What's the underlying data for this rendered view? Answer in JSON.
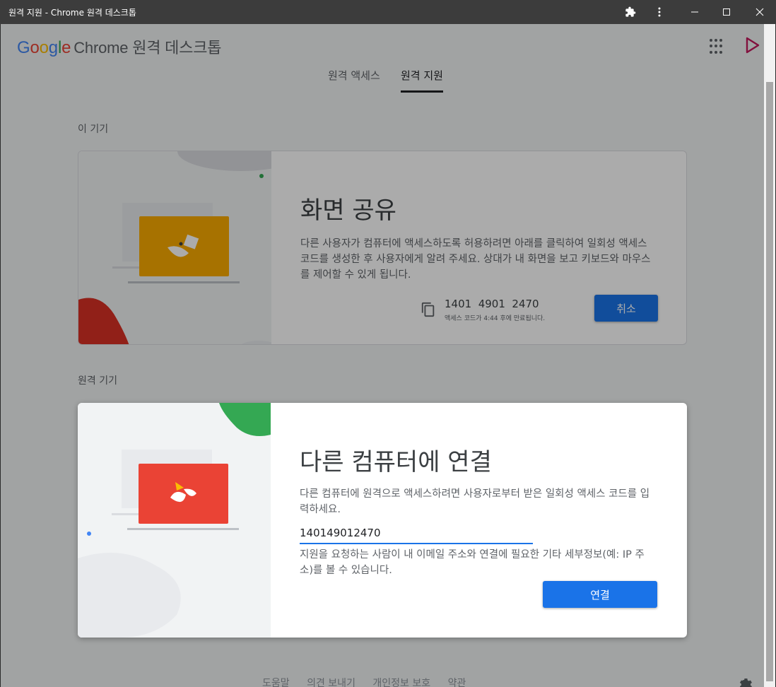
{
  "window": {
    "title": "원격 지원 - Chrome 원격 데스크톱",
    "icons": [
      "extension-icon",
      "more-vert-icon",
      "minimize-icon",
      "maximize-icon",
      "close-icon"
    ]
  },
  "appbar": {
    "logo": {
      "g": "G",
      "o1": "o",
      "o2": "o",
      "g2": "g",
      "l": "l",
      "e": "e",
      "rest": "Chrome 원격 데스크톱"
    }
  },
  "tabs": [
    {
      "label": "원격 액세스",
      "active": false
    },
    {
      "label": "원격 지원",
      "active": true
    }
  ],
  "this_device": {
    "section_label": "이 기기",
    "title": "화면 공유",
    "description": "다른 사용자가 컴퓨터에 액세스하도록 허용하려면 아래를 클릭하여 일회성 액세스 코드를 생성한 후 사용자에게 알려 주세요. 상대가 내 화면을 보고 키보드와 마우스를 제어할 수 있게 됩니다.",
    "code": "1401  4901  2470",
    "expiry": "액세스 코드가 4:44 후에 만료됩니다.",
    "cancel_label": "취소"
  },
  "remote_device": {
    "section_label": "원격 기기",
    "title": "다른 컴퓨터에 연결",
    "description": "다른 컴퓨터에 원격으로 액세스하려면 사용자로부터 받은 일회성 액세스 코드를 입력하세요.",
    "code_value": "140149012470",
    "notice": "지원을 요청하는 사람이 내 이메일 주소와 연결에 필요한 기타 세부정보(예: IP 주소)를 볼 수 있습니다.",
    "connect_label": "연결"
  },
  "footer": {
    "links": [
      "도움말",
      "의견 보내기",
      "개인정보 보호",
      "약관"
    ]
  },
  "colors": {
    "accent": "#1a73e8",
    "share_screen": "#f9ab00",
    "connect_screen": "#ea4335",
    "blob_green": "#34a853",
    "blob_red": "#d93025"
  }
}
